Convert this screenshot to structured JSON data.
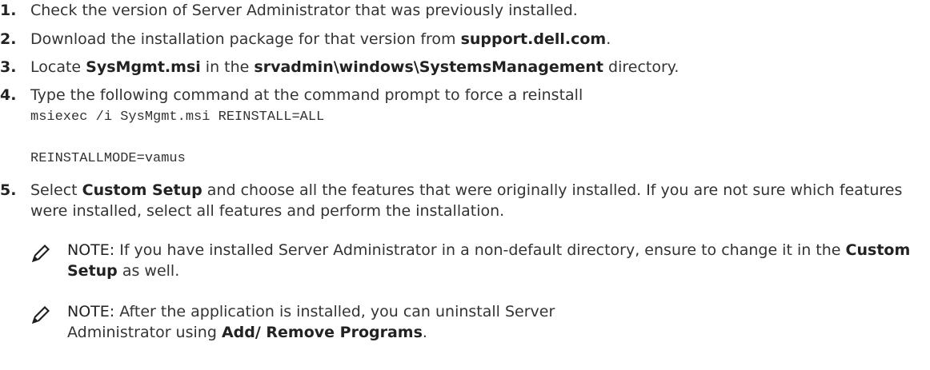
{
  "steps": [
    {
      "num": "1.",
      "text": "Check the version of Server Administrator that was previously installed."
    },
    {
      "num": "2.",
      "pre": "Download the installation package for that version from ",
      "bold": "support.dell.com",
      "post": "."
    },
    {
      "num": "3.",
      "pre": "Locate ",
      "bold1": "SysMgmt.msi",
      "mid": " in the ",
      "bold2": "srvadmin\\windows\\SystemsManagement",
      "post": " directory."
    },
    {
      "num": "4.",
      "text": "Type the following command at the command prompt to force a reinstall",
      "code_line1": "msiexec /i SysMgmt.msi REINSTALL=ALL",
      "code_line2": "REINSTALLMODE=vamus"
    },
    {
      "num": "5.",
      "pre": "Select ",
      "bold": "Custom Setup",
      "post": " and choose all the features that were originally installed. If you are not sure which features were installed, select all features and perform the installation."
    }
  ],
  "notes": [
    {
      "icon": "pencil-note-icon",
      "label": "NOTE:",
      "pre": " If you have installed Server Administrator in a non-default directory, ensure to change it in the ",
      "bold": "Custom Setup",
      "post": " as well."
    },
    {
      "icon": "pencil-note-icon",
      "label": "NOTE:",
      "pre": " After the application is installed, you can uninstall Server Administrator using ",
      "bold": "Add/ Remove Programs",
      "post": "."
    }
  ]
}
